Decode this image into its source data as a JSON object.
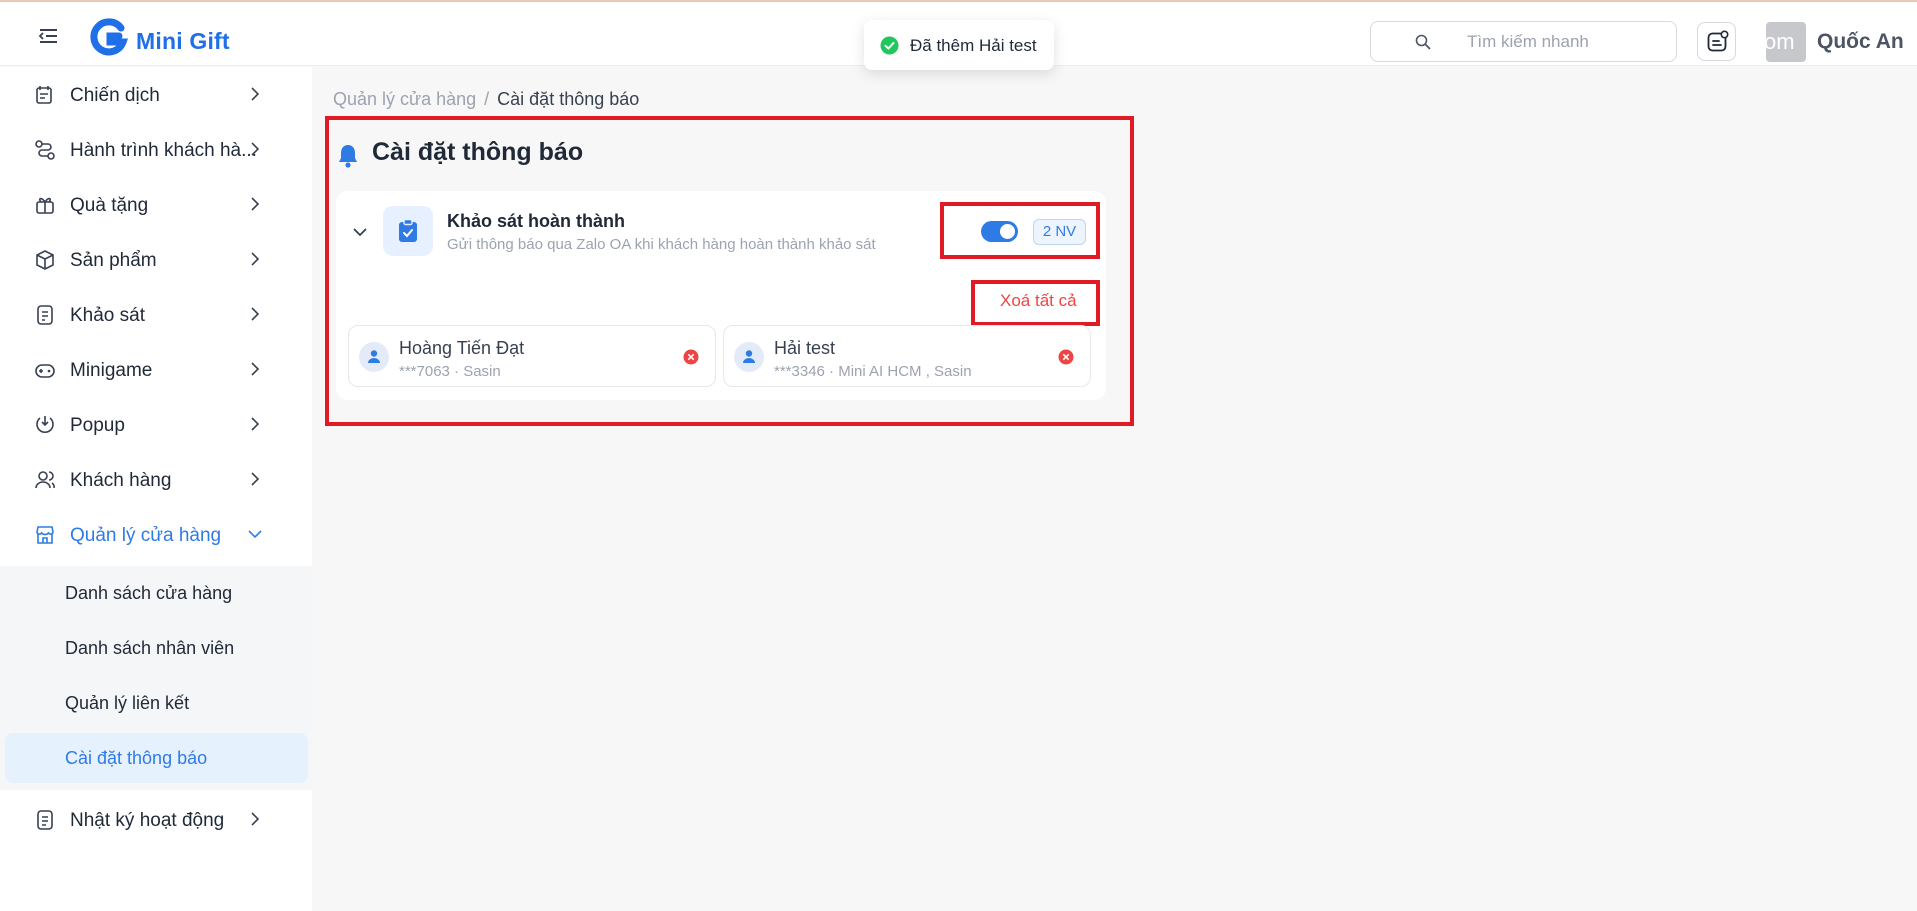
{
  "header": {
    "brand": "Mini Gift",
    "search_placeholder": "Tìm kiếm nhanh",
    "avatar_text": "om",
    "user_name": "Quốc An"
  },
  "toast": {
    "message": "Đã thêm Hải test"
  },
  "sidebar": {
    "items": [
      {
        "label": "Chiến dịch",
        "icon": "campaign-icon"
      },
      {
        "label": "Hành trình khách hà...",
        "icon": "journey-icon"
      },
      {
        "label": "Quà tặng",
        "icon": "gift-icon"
      },
      {
        "label": "Sản phẩm",
        "icon": "product-icon"
      },
      {
        "label": "Khảo sát",
        "icon": "survey-icon"
      },
      {
        "label": "Minigame",
        "icon": "gamepad-icon"
      },
      {
        "label": "Popup",
        "icon": "popup-icon"
      },
      {
        "label": "Khách hàng",
        "icon": "customers-icon"
      },
      {
        "label": "Quản lý cửa hàng",
        "icon": "store-icon"
      },
      {
        "label": "Nhật ký hoạt động",
        "icon": "activity-log-icon"
      }
    ],
    "submenu": [
      {
        "label": "Danh sách cửa hàng"
      },
      {
        "label": "Danh sách nhân viên"
      },
      {
        "label": "Quản lý liên kết"
      },
      {
        "label": "Cài đặt thông báo"
      }
    ]
  },
  "breadcrumb": {
    "parent": "Quản lý cửa hàng",
    "separator": "/",
    "current": "Cài đặt thông báo"
  },
  "page": {
    "title": "Cài đặt thông báo"
  },
  "notification_card": {
    "title": "Khảo sát hoàn thành",
    "description": "Gửi thông báo qua Zalo OA khi khách hàng hoàn thành khảo sát",
    "enabled": true,
    "count_badge": "2 NV",
    "clear_all": "Xoá tất cả",
    "staff": [
      {
        "name": "Hoàng Tiến Đạt",
        "meta": "***7063 · Sasin"
      },
      {
        "name": "Hải test",
        "meta": "***3346 · Mini AI HCM , Sasin"
      }
    ]
  },
  "colors": {
    "accent": "#2f7be5",
    "highlight": "#e01b24",
    "danger": "#ef4444",
    "success": "#22c55e"
  }
}
